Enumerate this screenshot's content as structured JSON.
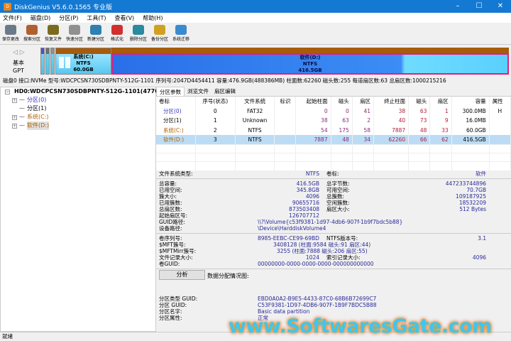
{
  "window": {
    "title": "DiskGenius V5.6.0.1565 专业版",
    "minimize": "–",
    "maximize": "☐",
    "close": "✕"
  },
  "menu": [
    "文件(F)",
    "磁盘(D)",
    "分区(P)",
    "工具(T)",
    "查看(V)",
    "帮助(H)"
  ],
  "toolbar": [
    {
      "label": "保存更改",
      "icon": "save-icon",
      "color": "#6a7a8a"
    },
    {
      "label": "搜索分区",
      "icon": "search-icon",
      "color": "#b06030"
    },
    {
      "label": "恢复文件",
      "icon": "recover-file-icon",
      "color": "#7a6a20"
    },
    {
      "label": "快速分区",
      "icon": "quick-partition-icon",
      "color": "#909090"
    },
    {
      "label": "新建分区",
      "icon": "new-partition-icon",
      "color": "#2f7fb0"
    },
    {
      "label": "格式化",
      "icon": "format-icon",
      "color": "#d03030"
    },
    {
      "label": "删除分区",
      "icon": "delete-partition-icon",
      "color": "#2a8aa0"
    },
    {
      "label": "备份分区",
      "icon": "backup-partition-icon",
      "color": "#d0a020"
    },
    {
      "label": "系统迁移",
      "icon": "system-migrate-icon",
      "color": "#3a8ad0"
    }
  ],
  "diskmap": {
    "nav_back": "◁",
    "nav_fwd": "▷",
    "type1": "基本",
    "type2": "GPT",
    "c": {
      "name": "系统(C:)",
      "fs": "NTFS",
      "size": "60.0GB"
    },
    "d": {
      "name": "软件(D:)",
      "fs": "NTFS",
      "size": "416.5GB"
    }
  },
  "diskinfo": "磁盘0 接口:NVMe  型号:WDCPCSN730SDBPNTY-512G-1101  序列号:2047D4454411  容量:476.9GB(488386MB)  柱面数:62260  磁头数:255  每道扇区数:63  总扇区数:1000215216",
  "tree": {
    "disk": "HD0:WDCPCSN730SDBPNTY-512G-1101(477GB)",
    "items": [
      {
        "label": "分区(0)",
        "color": "#3030c0",
        "exp": true
      },
      {
        "label": "分区(1)",
        "color": "#000000",
        "exp": false
      },
      {
        "label": "系统(C:)",
        "color": "#b06000",
        "exp": true
      },
      {
        "label": "软件(D:)",
        "color": "#b06000",
        "exp": true
      }
    ]
  },
  "tabs": [
    "分区参数",
    "浏览文件",
    "扇区编辑"
  ],
  "table": {
    "headers": [
      "卷标",
      "序号(状态)",
      "文件系统",
      "标识",
      "起始柱面",
      "磁头",
      "扇区",
      "终止柱面",
      "磁头",
      "扇区",
      "容量",
      "属性"
    ],
    "rows": [
      [
        "分区(0)",
        "0",
        "FAT32",
        "",
        "0",
        "0",
        "41",
        "38",
        "63",
        "1",
        "300.0MB",
        "H"
      ],
      [
        "分区(1)",
        "1",
        "Unknown",
        "",
        "38",
        "63",
        "2",
        "40",
        "73",
        "9",
        "16.0MB",
        ""
      ],
      [
        "系统(C:)",
        "2",
        "NTFS",
        "",
        "54",
        "175",
        "58",
        "7887",
        "48",
        "33",
        "60.0GB",
        ""
      ],
      [
        "软件(D:)",
        "3",
        "NTFS",
        "",
        "7887",
        "48",
        "34",
        "62260",
        "66",
        "62",
        "416.5GB",
        ""
      ]
    ]
  },
  "details": {
    "fs_type_label": "文件系统类型:",
    "fs_type": "NTFS",
    "vol_label_label": "卷标:",
    "vol_label": "软件",
    "grid": [
      [
        "总容量:",
        "416.5GB",
        "总字节数:",
        "447233744896"
      ],
      [
        "已用空间:",
        "345.8GB",
        "可用空间:",
        "70.7GB"
      ],
      [
        "簇大小:",
        "4096",
        "总簇数:",
        "109187925"
      ],
      [
        "已用簇数:",
        "90655716",
        "空闲簇数:",
        "18532209"
      ],
      [
        "总扇区数:",
        "873503408",
        "扇区大小:",
        "512 Bytes"
      ],
      [
        "起始扇区号:",
        "126707712",
        "",
        ""
      ]
    ],
    "guid_path_label": "GUID路径:",
    "guid_path": "\\\\?\\Volume{c53f9381-1d97-4db6-907f-1b9f7bdc5b88}",
    "dev_path_label": "设备路径:",
    "dev_path": "\\Device\\HarddiskVolume4",
    "serial_label": "卷序列号:",
    "serial": "8985-EEBC-CE99-69BD",
    "ntfs_ver_label": "NTFS版本号:",
    "ntfs_ver": "3.1",
    "mft_label": "$MFT簇号:",
    "mft": "3408128 (柱面:9584 磁头:91 扇区:44)",
    "mftmirr_label": "$MFTMirr簇号:",
    "mftmirr": "3255 (柱面:7888 磁头:206 扇区:55)",
    "frs_label": "文件记录大小:",
    "frs": "1024",
    "irs_label": "索引记录大小:",
    "irs": "4096",
    "vguid_label": "卷GUID:",
    "vguid": "00000000-0000-0000-0000-000000000000",
    "analyze": "分析",
    "datamap_label": "数据分配情况图:",
    "ptype_label": "分区类型 GUID:",
    "ptype": "EBD0A0A2-B9E5-4433-87C0-68B6B72699C7",
    "pguid_label": "分区 GUID:",
    "pguid": "C53F9381-1D97-4DB6-907F-1B9F7BDC5B88",
    "pname_label": "分区名字:",
    "pname": "Basic data partition",
    "pattr_label": "分区属性:",
    "pattr": "正常"
  },
  "status": "就绪",
  "watermark": "www.SoftwaresGate.com"
}
